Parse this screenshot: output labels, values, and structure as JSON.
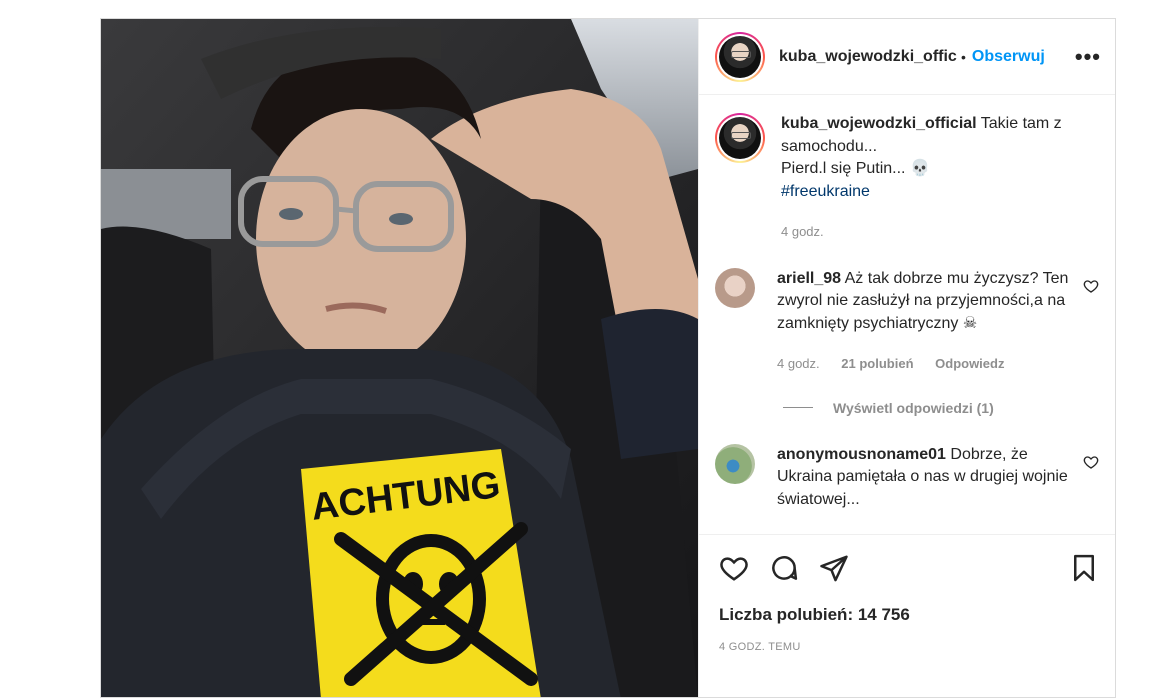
{
  "post": {
    "username": "kuba_wojewodzki_official",
    "username_truncated": "kuba_wojewodzki_offic",
    "separator": "•",
    "follow_label": "Obserwuj",
    "more_label": "•••",
    "caption_line1": "Takie tam z samochodu...",
    "caption_line2": "Pierd.l się Putin...",
    "caption_emoji": "💀",
    "hashtag": "#freeukraine",
    "caption_time": "4 godz."
  },
  "photo": {
    "shirt_text": "ACHTUNG"
  },
  "comments": [
    {
      "username": "ariell_98",
      "text": "Aż tak dobrze mu życzysz? Ten zwyrol nie zasłużył na przyjemności,a na zamknięty psychiatryczny",
      "emoji": "☠",
      "time": "4 godz.",
      "likes": "21 polubień",
      "reply": "Odpowiedz",
      "view_replies": "Wyświetl odpowiedzi (1)"
    },
    {
      "username": "anonymousnoname01",
      "text": "Dobrze, że Ukraina pamiętała o nas w drugiej wojnie światowej..."
    }
  ],
  "footer": {
    "likes_label": "Liczba polubień: 14 756",
    "posted_time": "4 GODZ. TEMU"
  },
  "colors": {
    "accent": "#0095f6",
    "text": "#262626",
    "muted": "#8e8e8e",
    "shirt_yellow": "#f4dc1c"
  }
}
